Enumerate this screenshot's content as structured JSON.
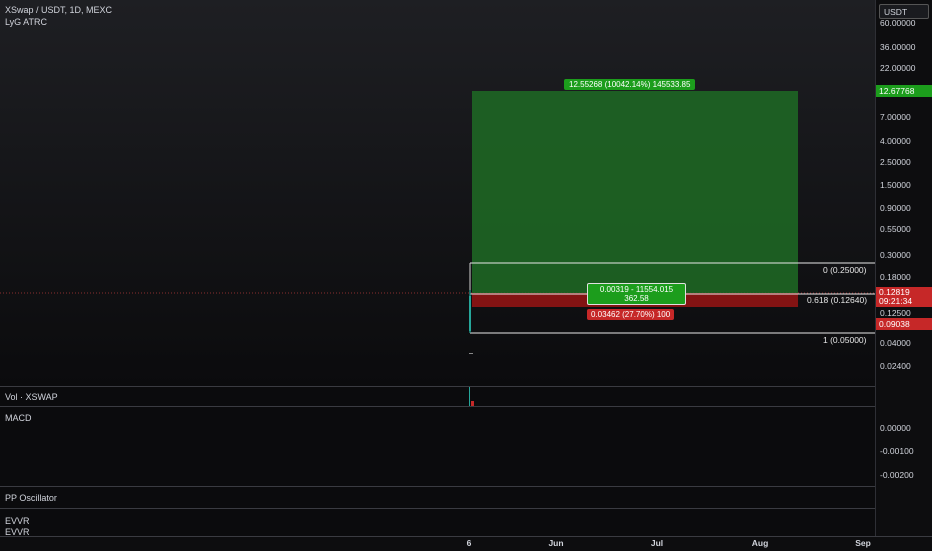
{
  "header": {
    "title": "XSwap / USDT, 1D, MEXC",
    "indicator": "LyG ATRC"
  },
  "currency_button": "USDT",
  "price_axis": {
    "ticks": [
      "60.00000",
      "36.00000",
      "22.00000",
      "12.67768",
      "7.00000",
      "4.00000",
      "2.50000",
      "1.50000",
      "0.90000",
      "0.55000",
      "0.30000",
      "0.18000",
      "0.12819",
      "09:21:34",
      "0.12500",
      "0.09038",
      "0.04000",
      "0.02400"
    ],
    "current_price": "0.12819",
    "countdown": "09:21:34",
    "target_price": "12.67768",
    "stop_price": "0.09038"
  },
  "labels": {
    "target": "12.55268 (10042.14%) 145533.85",
    "center_line1": "0.00319 - 11554.015",
    "center_line2": "362.58",
    "stop": "0.03462 (27.70%) 100",
    "fib_0": "0 (0.25000)",
    "fib_618": "0.618 (0.12640)",
    "fib_1": "1 (0.05000)"
  },
  "panes": {
    "volume": "Vol · XSWAP",
    "macd": "MACD",
    "macd_ticks": [
      "0.00000",
      "-0.00100",
      "-0.00200"
    ],
    "pp": "PP Oscillator",
    "evvr": "EVVR",
    "evvr2": "EVVR"
  },
  "time_axis": [
    "6",
    "Jun",
    "Jul",
    "Aug",
    "Sep"
  ],
  "colors": {
    "profit": "#1e8e2a",
    "loss": "#b22222",
    "background": "#0e0e10"
  },
  "chart_data": {
    "type": "position",
    "title": "XSwap / USDT, 1D, MEXC",
    "entry": 0.125,
    "target": 12.67768,
    "stop": 0.09038,
    "current": 0.12819,
    "fib_levels": [
      {
        "level": 0,
        "price": 0.25
      },
      {
        "level": 0.618,
        "price": 0.1264
      },
      {
        "level": 1,
        "price": 0.05
      }
    ],
    "y_scale": "log",
    "x_ticks": [
      "6",
      "Jun",
      "Jul",
      "Aug",
      "Sep"
    ]
  }
}
